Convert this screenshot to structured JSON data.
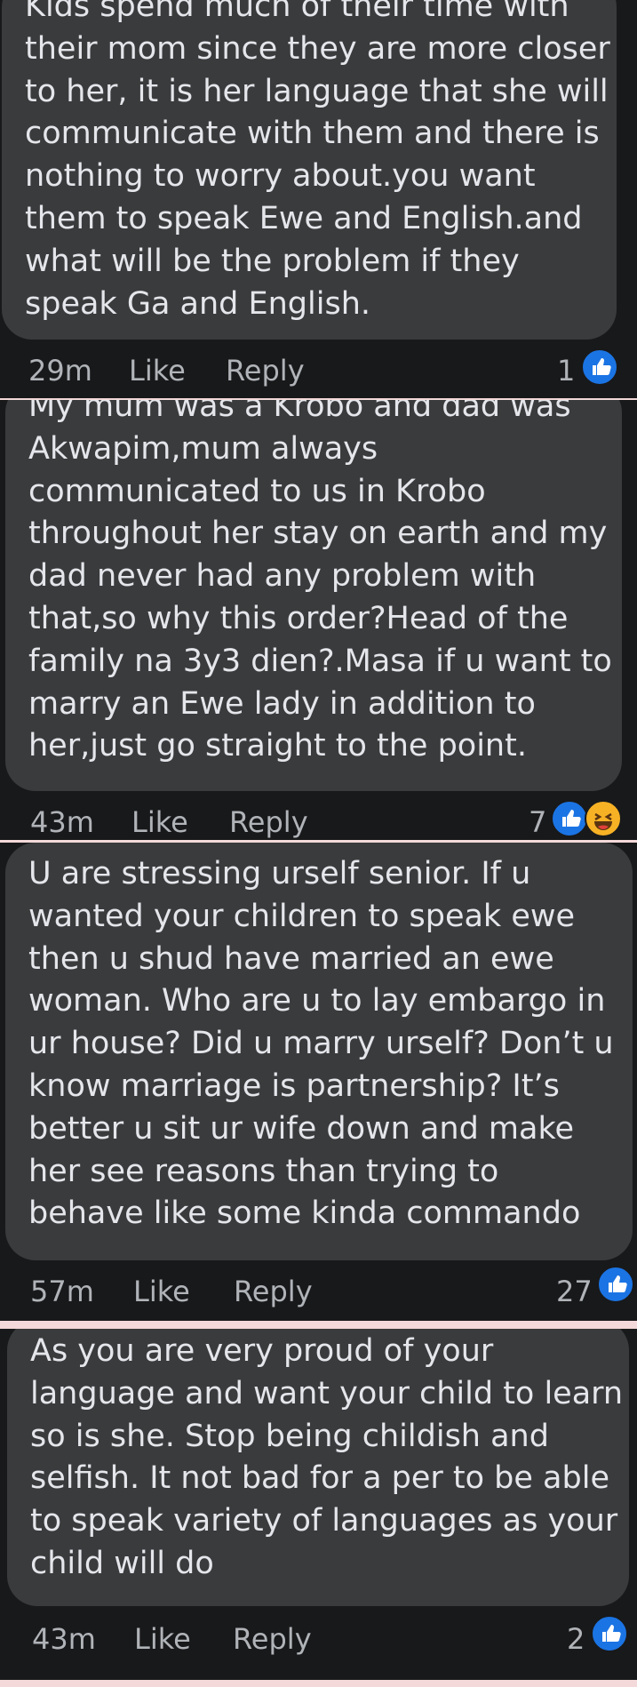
{
  "comments": [
    {
      "lines": [
        "Kids spend much of their time with",
        "their mom since they are more closer",
        "to her, it is her language that she will",
        "communicate with them and there is",
        "nothing to worry about.you want",
        "them to speak Ewe and English.and",
        "what will be the problem if they",
        "speak Ga and English."
      ],
      "time": "29m",
      "like_label": "Like",
      "reply_label": "Reply",
      "reaction_count": "1",
      "reactions": [
        "like-icon"
      ]
    },
    {
      "lines": [
        "My mum was a Krobo and dad was",
        "Akwapim,mum always",
        "communicated to us in Krobo",
        "throughout her stay on earth and my",
        "dad never had any problem with",
        "that,so why this order?Head of the",
        "family na 3y3 dien?.Masa if u want to",
        "marry an Ewe lady in addition to",
        "her,just go straight to the point."
      ],
      "time": "43m",
      "like_label": "Like",
      "reply_label": "Reply",
      "reaction_count": "7",
      "reactions": [
        "like-icon",
        "haha-icon"
      ]
    },
    {
      "lines": [
        "U are stressing urself senior.  If u",
        "wanted your children to speak ewe",
        "then u shud have married an ewe",
        "woman. Who are u to lay embargo in",
        "ur house? Did u marry urself? Don’t u",
        "know marriage is partnership? It’s",
        "better u sit ur wife down and make",
        "her see reasons than trying to",
        "behave like some kinda commando"
      ],
      "time": "57m",
      "like_label": "Like",
      "reply_label": "Reply",
      "reaction_count": "27",
      "reactions": [
        "like-icon"
      ]
    },
    {
      "lines": [
        "As you are very proud of your",
        "language and want your child to learn",
        "so is she. Stop being childish and",
        "selfish. It not bad for a per to be able",
        "to speak variety of languages as your",
        "child will do"
      ],
      "time": "43m",
      "like_label": "Like",
      "reply_label": "Reply",
      "reaction_count": "2",
      "reactions": [
        "like-icon"
      ]
    }
  ],
  "colors": {
    "background": "#18191a",
    "bubble": "#3a3b3c",
    "text": "#e4e6eb",
    "meta": "#b0b3b8",
    "like": "#1b74e4",
    "haha": "#f7b125",
    "separator": "#f3d9d9"
  }
}
